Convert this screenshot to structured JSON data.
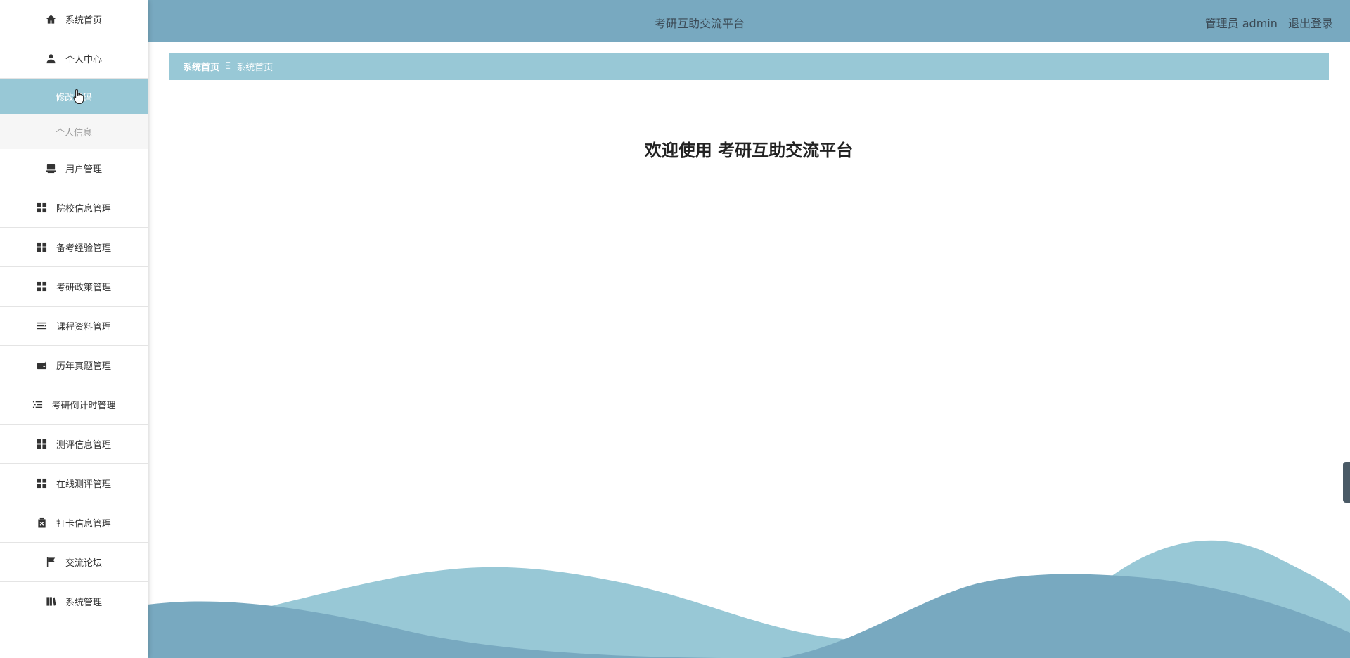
{
  "header": {
    "title": "考研互助交流平台",
    "user_label": "管理员 admin",
    "logout_label": "退出登录"
  },
  "sidebar": {
    "items": [
      {
        "label": "系统首页",
        "icon": "home-icon"
      },
      {
        "label": "个人中心",
        "icon": "user-icon"
      },
      {
        "label": "用户管理",
        "icon": "users-icon"
      },
      {
        "label": "院校信息管理",
        "icon": "grid-icon"
      },
      {
        "label": "备考经验管理",
        "icon": "grid-icon"
      },
      {
        "label": "考研政策管理",
        "icon": "grid-icon"
      },
      {
        "label": "课程资料管理",
        "icon": "list-icon"
      },
      {
        "label": "历年真题管理",
        "icon": "wallet-icon"
      },
      {
        "label": "考研倒计时管理",
        "icon": "list-icon"
      },
      {
        "label": "测评信息管理",
        "icon": "grid-icon"
      },
      {
        "label": "在线测评管理",
        "icon": "grid-icon"
      },
      {
        "label": "打卡信息管理",
        "icon": "clipboard-icon"
      },
      {
        "label": "交流论坛",
        "icon": "flag-icon"
      },
      {
        "label": "系统管理",
        "icon": "book-icon"
      }
    ],
    "sub_items": [
      {
        "label": "修改密码",
        "active": true
      },
      {
        "label": "个人信息",
        "active": false
      }
    ]
  },
  "breadcrumb": {
    "home": "系统首页",
    "separator": "Ξ",
    "current": "系统首页"
  },
  "main": {
    "welcome": "欢迎使用 考研互助交流平台"
  },
  "colors": {
    "header_bg": "#78a9c0",
    "accent": "#98c8d6",
    "wave_dark": "#78a9c0",
    "wave_light": "#98c8d6"
  }
}
